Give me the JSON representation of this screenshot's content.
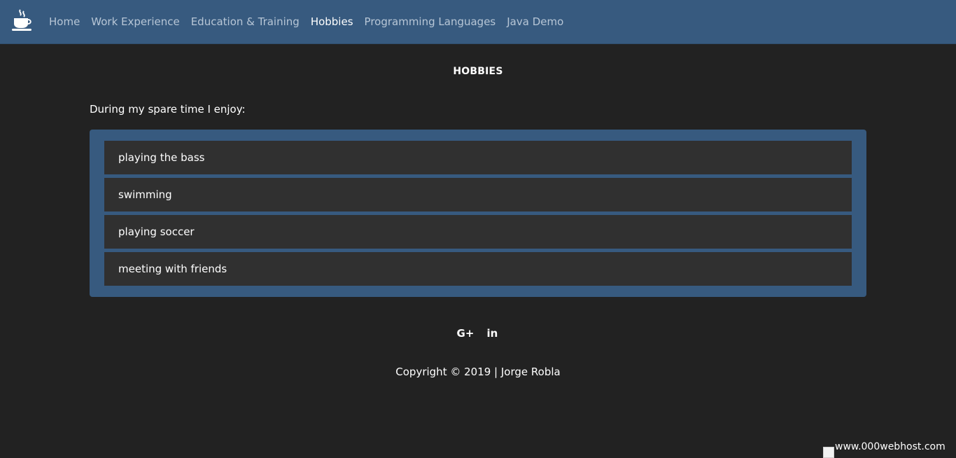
{
  "nav": {
    "brand_icon": "coffee-cup-icon",
    "items": [
      {
        "label": "Home",
        "active": false
      },
      {
        "label": "Work Experience",
        "active": false
      },
      {
        "label": "Education & Training",
        "active": false
      },
      {
        "label": "Hobbies",
        "active": true
      },
      {
        "label": "Programming Languages",
        "active": false
      },
      {
        "label": "Java Demo",
        "active": false
      }
    ]
  },
  "main": {
    "title": "HOBBIES",
    "intro": "During my spare time I enjoy:",
    "hobbies": [
      "playing the bass",
      "swimming",
      "playing soccer",
      "meeting with friends"
    ]
  },
  "footer": {
    "social": [
      {
        "icon": "google-plus-icon",
        "glyph": "G+"
      },
      {
        "icon": "linkedin-icon",
        "glyph": "in"
      }
    ],
    "copyright": "Copyright © 2019 | Jorge Robla"
  },
  "host_badge": {
    "alt": "www.000webhost.com"
  },
  "colors": {
    "navbar": "#375a7f",
    "background": "#222222",
    "list_item": "#303030",
    "text": "#ffffff",
    "nav_inactive": "#b7c6d6"
  }
}
